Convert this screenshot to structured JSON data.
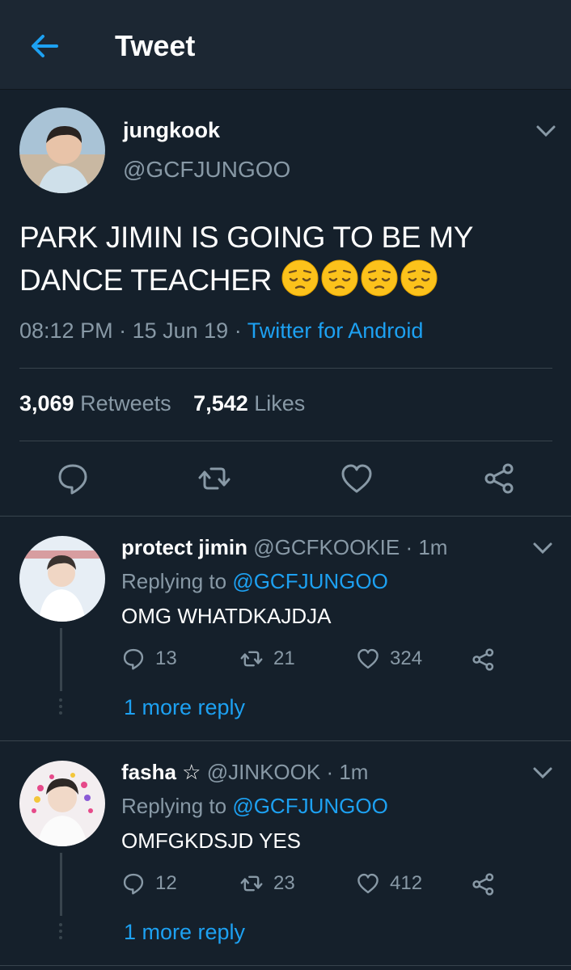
{
  "header": {
    "title": "Tweet",
    "back_icon": "back-arrow-icon"
  },
  "tweet": {
    "name": "jungkook",
    "handle": "@GCFJUNGOO",
    "text": "PARK JIMIN IS GOING TO BE MY DANCE TEACHER",
    "emoji": [
      "pensive-face",
      "pensive-face",
      "pensive-face",
      "pensive-face"
    ],
    "time": "08:12 PM",
    "date": "15 Jun 19",
    "source": "Twitter for Android",
    "retweets_count": "3,069",
    "retweets_label": "Retweets",
    "likes_count": "7,542",
    "likes_label": "Likes"
  },
  "replies": [
    {
      "name": "protect jimin",
      "handle": "@GCFKOOKIE",
      "time": "1m",
      "replying_label": "Replying to",
      "replying_to": "@GCFJUNGOO",
      "text": "OMG WHATDKAJDJA",
      "replies": "13",
      "retweets": "21",
      "likes": "324",
      "more": "1 more reply"
    },
    {
      "name": "fasha ☆",
      "handle": "@JINKOOK",
      "time": "1m",
      "replying_label": "Replying to",
      "replying_to": "@GCFJUNGOO",
      "text": "OMFGKDSJD YES",
      "replies": "12",
      "retweets": "23",
      "likes": "412",
      "more": "1 more reply"
    }
  ],
  "colors": {
    "background": "#15202b",
    "header": "#1c2733",
    "accent": "#1da1f2",
    "muted": "#8899a6",
    "divider": "#38444d"
  }
}
